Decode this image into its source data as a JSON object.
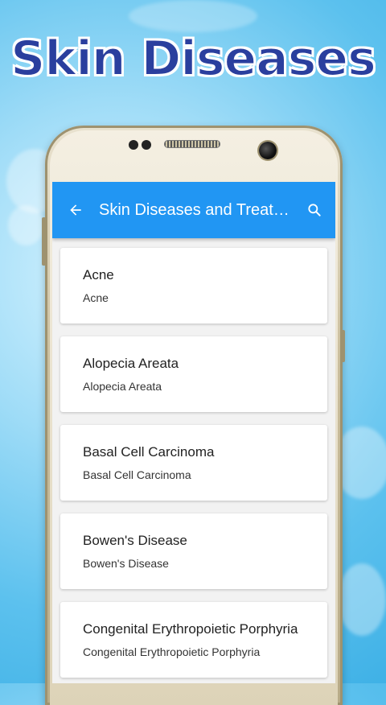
{
  "promo": {
    "headline": "Skin Diseases"
  },
  "colors": {
    "appbar": "#2196f3",
    "headline": "#2a3f9e",
    "background": "#5cc1ee"
  },
  "appbar": {
    "back_icon": "arrow-left-icon",
    "title": "Skin Diseases and Treatm...",
    "search_icon": "search-icon"
  },
  "items": [
    {
      "title": "Acne",
      "subtitle": "Acne"
    },
    {
      "title": "Alopecia Areata",
      "subtitle": "Alopecia Areata"
    },
    {
      "title": "Basal Cell Carcinoma",
      "subtitle": "Basal Cell Carcinoma"
    },
    {
      "title": "Bowen's Disease",
      "subtitle": "Bowen's Disease"
    },
    {
      "title": "Congenital Erythropoietic Porphyria",
      "subtitle": "Congenital Erythropoietic Porphyria"
    }
  ]
}
